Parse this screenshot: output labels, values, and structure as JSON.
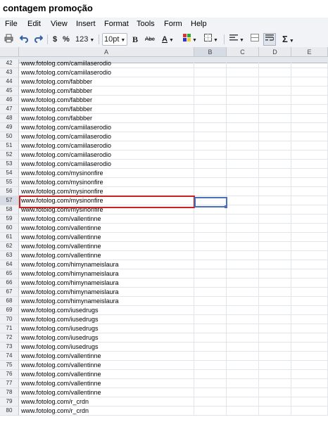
{
  "doc_title": "contagem promoção",
  "menu": [
    "File",
    "Edit",
    "View",
    "Insert",
    "Format",
    "Tools",
    "Form",
    "Help"
  ],
  "toolbar": {
    "dollar": "$",
    "percent": "%",
    "number_format": "123",
    "font_size": "10pt",
    "bold": "B",
    "strike": "Abc",
    "text_color": "A",
    "sum": "Σ"
  },
  "columns": [
    "A",
    "B",
    "C",
    "D",
    "E"
  ],
  "selected_column": "B",
  "rows": [
    {
      "n": "42",
      "a": "www.fotolog.com/camiilaserodio"
    },
    {
      "n": "43",
      "a": "www.fotolog.com/camiilaserodio"
    },
    {
      "n": "44",
      "a": "www.fotolog.com/fabbber"
    },
    {
      "n": "45",
      "a": "www.fotolog.com/fabbber"
    },
    {
      "n": "46",
      "a": "www.fotolog.com/fabbber"
    },
    {
      "n": "47",
      "a": "www.fotolog.com/fabbber"
    },
    {
      "n": "48",
      "a": "www.fotolog.com/fabbber"
    },
    {
      "n": "49",
      "a": "www.fotolog.com/camiilaserodio"
    },
    {
      "n": "50",
      "a": "www.fotolog.com/camiilaserodio"
    },
    {
      "n": "51",
      "a": "www.fotolog.com/camiilaserodio"
    },
    {
      "n": "52",
      "a": "www.fotolog.com/camiilaserodio"
    },
    {
      "n": "53",
      "a": "www.fotolog.com/camiilaserodio"
    },
    {
      "n": "54",
      "a": "www.fotolog.com/mysinonfire"
    },
    {
      "n": "55",
      "a": "www.fotolog.com/mysinonfire"
    },
    {
      "n": "56",
      "a": "www.fotolog.com/mysinonfire"
    },
    {
      "n": "57",
      "a": "www.fotolog.com/mysinonfire"
    },
    {
      "n": "58",
      "a": "www.fotolog.com/mysinonfire"
    },
    {
      "n": "59",
      "a": "www.fotolog.com/vallentinne"
    },
    {
      "n": "60",
      "a": "www.fotolog.com/vallentinne"
    },
    {
      "n": "61",
      "a": "www.fotolog.com/vallentinne"
    },
    {
      "n": "62",
      "a": "www.fotolog.com/vallentinne"
    },
    {
      "n": "63",
      "a": "www.fotolog.com/vallentinne"
    },
    {
      "n": "64",
      "a": "www.fotolog.com/himynameislaura"
    },
    {
      "n": "65",
      "a": "www.fotolog.com/himynameislaura"
    },
    {
      "n": "66",
      "a": "www.fotolog.com/himynameislaura"
    },
    {
      "n": "67",
      "a": "www.fotolog.com/himynameislaura"
    },
    {
      "n": "68",
      "a": "www.fotolog.com/himynameislaura"
    },
    {
      "n": "69",
      "a": "www.fotolog.com/iusedrugs"
    },
    {
      "n": "70",
      "a": "www.fotolog.com/iusedrugs"
    },
    {
      "n": "71",
      "a": "www.fotolog.com/iusedrugs"
    },
    {
      "n": "72",
      "a": "www.fotolog.com/iusedrugs"
    },
    {
      "n": "73",
      "a": "www.fotolog.com/iusedrugs"
    },
    {
      "n": "74",
      "a": "www.fotolog.com/vallentinne"
    },
    {
      "n": "75",
      "a": "www.fotolog.com/vallentinne"
    },
    {
      "n": "76",
      "a": "www.fotolog.com/vallentinne"
    },
    {
      "n": "77",
      "a": "www.fotolog.com/vallentinne"
    },
    {
      "n": "78",
      "a": "www.fotolog.com/vallentinne"
    },
    {
      "n": "79",
      "a": "www.fotolog.com/r_crdn"
    },
    {
      "n": "80",
      "a": "www.fotolog.com/r_crdn"
    }
  ],
  "selected_row": "57",
  "highlight_color": "#cc1f1f",
  "selection_color": "#4a6fbf"
}
